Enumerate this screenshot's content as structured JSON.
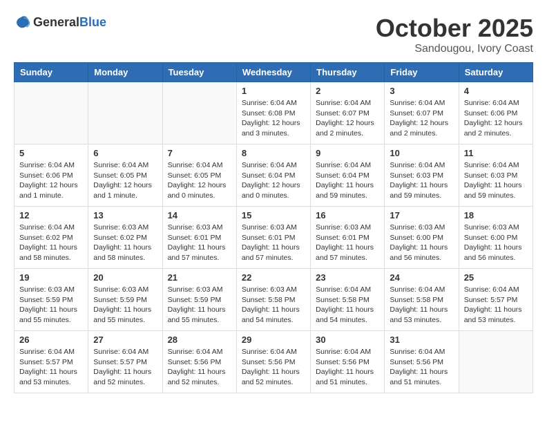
{
  "header": {
    "logo_general": "General",
    "logo_blue": "Blue",
    "month": "October 2025",
    "location": "Sandougou, Ivory Coast"
  },
  "weekdays": [
    "Sunday",
    "Monday",
    "Tuesday",
    "Wednesday",
    "Thursday",
    "Friday",
    "Saturday"
  ],
  "weeks": [
    [
      {
        "day": "",
        "info": ""
      },
      {
        "day": "",
        "info": ""
      },
      {
        "day": "",
        "info": ""
      },
      {
        "day": "1",
        "info": "Sunrise: 6:04 AM\nSunset: 6:08 PM\nDaylight: 12 hours\nand 3 minutes."
      },
      {
        "day": "2",
        "info": "Sunrise: 6:04 AM\nSunset: 6:07 PM\nDaylight: 12 hours\nand 2 minutes."
      },
      {
        "day": "3",
        "info": "Sunrise: 6:04 AM\nSunset: 6:07 PM\nDaylight: 12 hours\nand 2 minutes."
      },
      {
        "day": "4",
        "info": "Sunrise: 6:04 AM\nSunset: 6:06 PM\nDaylight: 12 hours\nand 2 minutes."
      }
    ],
    [
      {
        "day": "5",
        "info": "Sunrise: 6:04 AM\nSunset: 6:06 PM\nDaylight: 12 hours\nand 1 minute."
      },
      {
        "day": "6",
        "info": "Sunrise: 6:04 AM\nSunset: 6:05 PM\nDaylight: 12 hours\nand 1 minute."
      },
      {
        "day": "7",
        "info": "Sunrise: 6:04 AM\nSunset: 6:05 PM\nDaylight: 12 hours\nand 0 minutes."
      },
      {
        "day": "8",
        "info": "Sunrise: 6:04 AM\nSunset: 6:04 PM\nDaylight: 12 hours\nand 0 minutes."
      },
      {
        "day": "9",
        "info": "Sunrise: 6:04 AM\nSunset: 6:04 PM\nDaylight: 11 hours\nand 59 minutes."
      },
      {
        "day": "10",
        "info": "Sunrise: 6:04 AM\nSunset: 6:03 PM\nDaylight: 11 hours\nand 59 minutes."
      },
      {
        "day": "11",
        "info": "Sunrise: 6:04 AM\nSunset: 6:03 PM\nDaylight: 11 hours\nand 59 minutes."
      }
    ],
    [
      {
        "day": "12",
        "info": "Sunrise: 6:04 AM\nSunset: 6:02 PM\nDaylight: 11 hours\nand 58 minutes."
      },
      {
        "day": "13",
        "info": "Sunrise: 6:03 AM\nSunset: 6:02 PM\nDaylight: 11 hours\nand 58 minutes."
      },
      {
        "day": "14",
        "info": "Sunrise: 6:03 AM\nSunset: 6:01 PM\nDaylight: 11 hours\nand 57 minutes."
      },
      {
        "day": "15",
        "info": "Sunrise: 6:03 AM\nSunset: 6:01 PM\nDaylight: 11 hours\nand 57 minutes."
      },
      {
        "day": "16",
        "info": "Sunrise: 6:03 AM\nSunset: 6:01 PM\nDaylight: 11 hours\nand 57 minutes."
      },
      {
        "day": "17",
        "info": "Sunrise: 6:03 AM\nSunset: 6:00 PM\nDaylight: 11 hours\nand 56 minutes."
      },
      {
        "day": "18",
        "info": "Sunrise: 6:03 AM\nSunset: 6:00 PM\nDaylight: 11 hours\nand 56 minutes."
      }
    ],
    [
      {
        "day": "19",
        "info": "Sunrise: 6:03 AM\nSunset: 5:59 PM\nDaylight: 11 hours\nand 55 minutes."
      },
      {
        "day": "20",
        "info": "Sunrise: 6:03 AM\nSunset: 5:59 PM\nDaylight: 11 hours\nand 55 minutes."
      },
      {
        "day": "21",
        "info": "Sunrise: 6:03 AM\nSunset: 5:59 PM\nDaylight: 11 hours\nand 55 minutes."
      },
      {
        "day": "22",
        "info": "Sunrise: 6:03 AM\nSunset: 5:58 PM\nDaylight: 11 hours\nand 54 minutes."
      },
      {
        "day": "23",
        "info": "Sunrise: 6:04 AM\nSunset: 5:58 PM\nDaylight: 11 hours\nand 54 minutes."
      },
      {
        "day": "24",
        "info": "Sunrise: 6:04 AM\nSunset: 5:58 PM\nDaylight: 11 hours\nand 53 minutes."
      },
      {
        "day": "25",
        "info": "Sunrise: 6:04 AM\nSunset: 5:57 PM\nDaylight: 11 hours\nand 53 minutes."
      }
    ],
    [
      {
        "day": "26",
        "info": "Sunrise: 6:04 AM\nSunset: 5:57 PM\nDaylight: 11 hours\nand 53 minutes."
      },
      {
        "day": "27",
        "info": "Sunrise: 6:04 AM\nSunset: 5:57 PM\nDaylight: 11 hours\nand 52 minutes."
      },
      {
        "day": "28",
        "info": "Sunrise: 6:04 AM\nSunset: 5:56 PM\nDaylight: 11 hours\nand 52 minutes."
      },
      {
        "day": "29",
        "info": "Sunrise: 6:04 AM\nSunset: 5:56 PM\nDaylight: 11 hours\nand 52 minutes."
      },
      {
        "day": "30",
        "info": "Sunrise: 6:04 AM\nSunset: 5:56 PM\nDaylight: 11 hours\nand 51 minutes."
      },
      {
        "day": "31",
        "info": "Sunrise: 6:04 AM\nSunset: 5:56 PM\nDaylight: 11 hours\nand 51 minutes."
      },
      {
        "day": "",
        "info": ""
      }
    ]
  ]
}
